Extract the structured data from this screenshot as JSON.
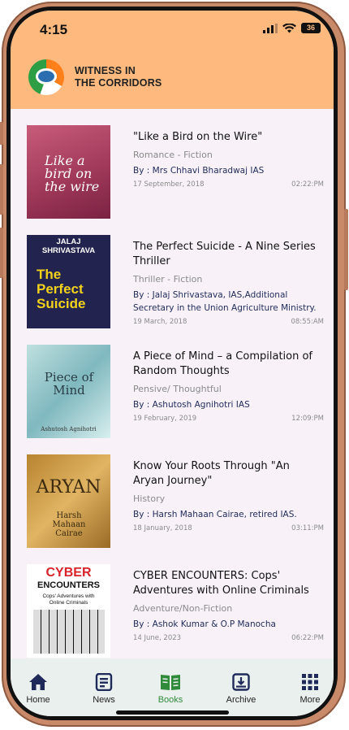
{
  "status": {
    "time": "4:15",
    "battery": "36"
  },
  "app": {
    "brand_line1": "WITNESS IN",
    "brand_line2": "THE CORRIDORS"
  },
  "books": [
    {
      "title": "\"Like a Bird on the Wire\"",
      "genre": "Romance - Fiction",
      "author": "By : Mrs Chhavi Bharadwaj IAS",
      "date": "17 September, 2018",
      "time": "02:22:PM",
      "cover_text": "Like a bird on the wire"
    },
    {
      "title": "The Perfect Suicide - A Nine Series Thriller",
      "genre": "Thriller - Fiction",
      "author": "By : Jalaj Shrivastava, IAS,Additional Secretary in the Union Agriculture Ministry.",
      "date": "19 March, 2018",
      "time": "08:55:AM",
      "cover_text": "JALAJ SHRIVASTAVA",
      "cover_text2": "The Perfect Suicide"
    },
    {
      "title": "A Piece of Mind – a Compilation of Random Thoughts",
      "genre": "Pensive/ Thoughtful",
      "author": "By : Ashutosh Agnihotri IAS",
      "date": "19 February, 2019",
      "time": "12:09:PM",
      "cover_text": "Piece of Mind",
      "cover_text2": "Ashutosh Agnihotri"
    },
    {
      "title": "Know Your Roots Through \"An Aryan Journey\"",
      "genre": "History",
      "author": "By : Harsh Mahaan Cairae, retired IAS.",
      "date": "18 January, 2018",
      "time": "03:11:PM",
      "cover_text": "ARYAN",
      "cover_text2": "Harsh Mahaan Cairae"
    },
    {
      "title": "CYBER ENCOUNTERS: Cops' Adventures with Online Criminals",
      "genre": "Adventure/Non-Fiction",
      "author": "By : Ashok Kumar & O.P Manocha",
      "date": "14 June, 2023",
      "time": "06:22:PM",
      "cover_text": "CYBER",
      "cover_text2": "ENCOUNTERS",
      "cover_text3": "Cops' Adventures with Online Criminals"
    }
  ],
  "nav": [
    {
      "label": "Home",
      "icon": "home-icon"
    },
    {
      "label": "News",
      "icon": "news-icon"
    },
    {
      "label": "Books",
      "icon": "book-icon",
      "active": true
    },
    {
      "label": "Archive",
      "icon": "archive-icon"
    },
    {
      "label": "More",
      "icon": "grid-icon"
    }
  ],
  "colors": {
    "header": "#fdb97e",
    "active": "#2f8a3a",
    "navy": "#1f2a5a",
    "nav_bg": "#eaf0ee"
  }
}
